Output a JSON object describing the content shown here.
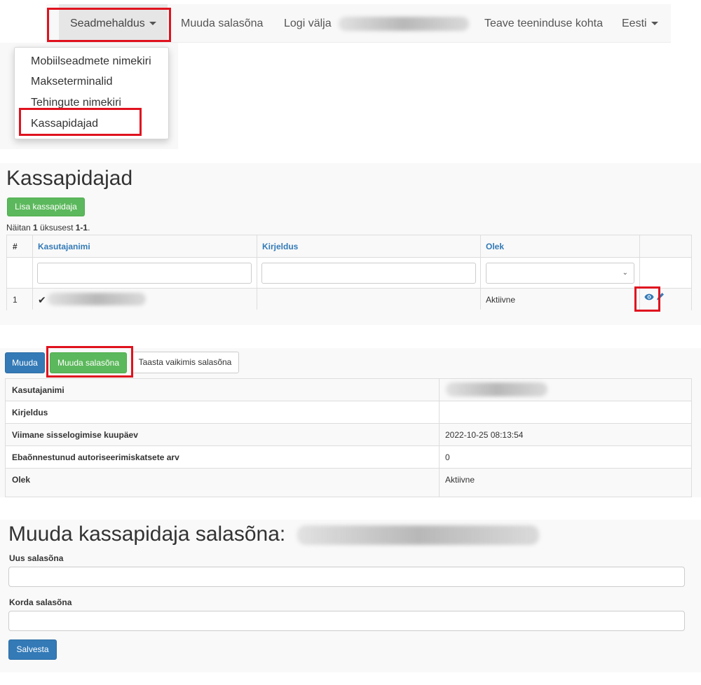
{
  "navbar": {
    "device_menu": "Seadmehaldus",
    "change_password": "Muuda salasõna",
    "logout": "Logi välja",
    "service_info": "Teave teeninduse kohta",
    "language": "Eesti"
  },
  "device_dropdown": {
    "items": [
      "Mobiilseadmete nimekiri",
      "Makseterminalid",
      "Tehingute nimekiri",
      "Kassapidajad"
    ]
  },
  "cashiers_page": {
    "title": "Kassapidajad",
    "add_button": "Lisa kassapidaja",
    "summary": {
      "prefix": "Näitan ",
      "count": "1",
      "middle": " üksusest ",
      "range": "1-1",
      "suffix": "."
    },
    "columns": [
      "#",
      "Kasutajanimi",
      "Kirjeldus",
      "Olek"
    ],
    "rows": [
      {
        "index": "1",
        "status": "Aktiivne"
      }
    ]
  },
  "cashier_view": {
    "buttons": {
      "edit": "Muuda",
      "change_password": "Muuda salasõna",
      "reset_password": "Taasta vaikimis salasõna"
    },
    "rows": [
      {
        "label": "Kasutajanimi",
        "value": ""
      },
      {
        "label": "Kirjeldus",
        "value": ""
      },
      {
        "label": "Viimane sisselogimise kuupäev",
        "value": "2022-10-25 08:13:54"
      },
      {
        "label": "Ebaõnnestunud autoriseerimiskatsete arv",
        "value": "0"
      },
      {
        "label": "Olek",
        "value": "Aktiivne"
      }
    ]
  },
  "password_form": {
    "title": "Muuda kassapidaja salasõna:",
    "new_password_label": "Uus salasõna",
    "repeat_password_label": "Korda salasõna",
    "save_button": "Salvesta"
  },
  "colors": {
    "highlight": "#e0121e",
    "success": "#5cb85c",
    "primary": "#337ab7"
  },
  "icons": [
    "caret-down-icon",
    "checkmark-icon",
    "eye-icon",
    "pencil-icon",
    "chevron-down-icon"
  ]
}
